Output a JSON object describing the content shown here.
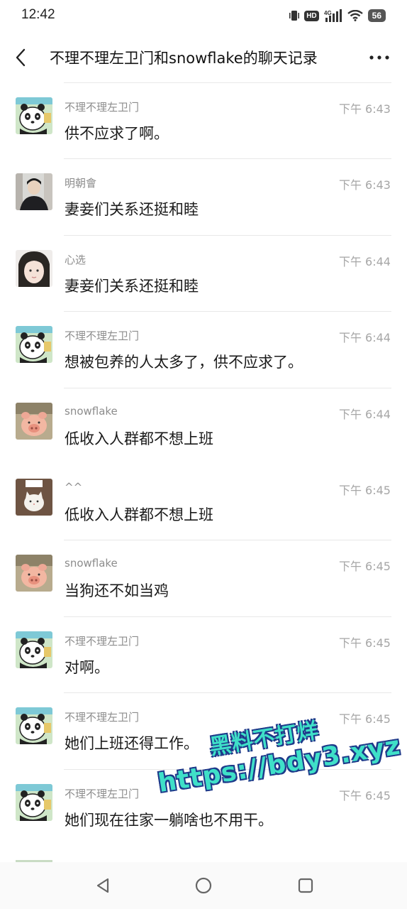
{
  "status_bar": {
    "time": "12:42",
    "icons": [
      "vibrate-icon",
      "hd-icon",
      "signal-icon",
      "wifi-icon",
      "battery-icon"
    ],
    "hd_label": "HD",
    "network_label": "4G",
    "battery_level": "56"
  },
  "nav": {
    "title": "不理不理左卫门和snowflake的聊天记录",
    "back_icon": "back-chevron-icon",
    "more_icon": "more-dots-icon"
  },
  "messages": [
    {
      "sender": "不理不理左卫门",
      "time": "下午 6:43",
      "text": "供不应求了啊。",
      "avatar": "panda"
    },
    {
      "sender": "明朝會",
      "time": "下午 6:43",
      "text": "妻妾们关系还挺和睦",
      "avatar": "person"
    },
    {
      "sender": "心选",
      "time": "下午 6:44",
      "text": "妻妾们关系还挺和睦",
      "avatar": "girl"
    },
    {
      "sender": "不理不理左卫门",
      "time": "下午 6:44",
      "text": "想被包养的人太多了，供不应求了。",
      "avatar": "panda"
    },
    {
      "sender": "snowflake",
      "time": "下午 6:44",
      "text": "低收入人群都不想上班",
      "avatar": "pig"
    },
    {
      "sender": "^^",
      "time": "下午 6:45",
      "text": "低收入人群都不想上班",
      "avatar": "cat"
    },
    {
      "sender": "snowflake",
      "time": "下午 6:45",
      "text": "当狗还不如当鸡",
      "avatar": "pig"
    },
    {
      "sender": "不理不理左卫门",
      "time": "下午 6:45",
      "text": "对啊。",
      "avatar": "panda"
    },
    {
      "sender": "不理不理左卫门",
      "time": "下午 6:45",
      "text": "她们上班还得工作。",
      "avatar": "panda"
    },
    {
      "sender": "不理不理左卫门",
      "time": "下午 6:45",
      "text": "她们现在往家一躺啥也不用干。",
      "avatar": "panda"
    }
  ],
  "watermark": {
    "line1": "黑料不打烊",
    "line2": "https://bdy3.xyz"
  },
  "system_nav": {
    "icons": [
      "nav-back-icon",
      "nav-home-icon",
      "nav-recent-icon"
    ]
  },
  "colors": {
    "sender_gray": "#8c8c8c",
    "time_gray": "#a6a6a6",
    "divider": "#e8e8e8",
    "watermark_fill": "#3fe0c8",
    "watermark_outline": "#1e3a8a"
  }
}
